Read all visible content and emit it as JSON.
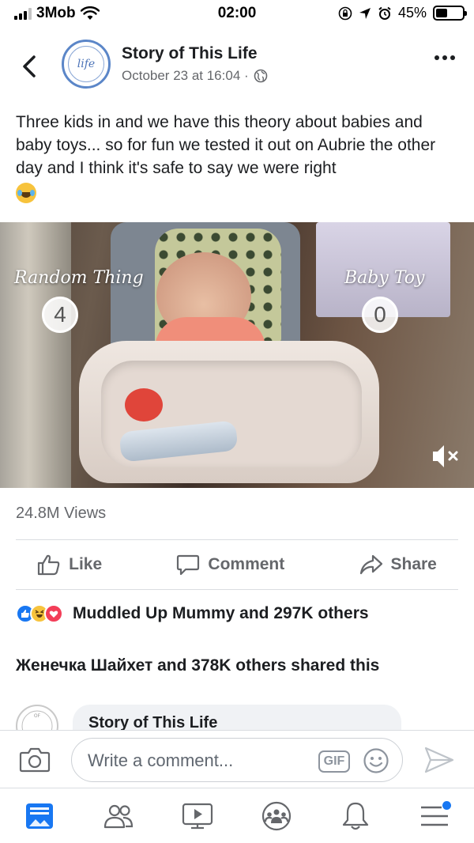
{
  "status_bar": {
    "carrier": "3Mob",
    "time": "02:00",
    "battery_percent": "45%",
    "battery_level": 0.45
  },
  "post": {
    "page_name": "Story of This Life",
    "timestamp": "October 23 at 16:04 ·",
    "text": "Three kids in and we have this theory about babies and baby toys... so for fun we tested it out on Aubrie the other day and I think it's safe to say we were right",
    "emoji": "face-with-tears-of-joy"
  },
  "video": {
    "left_label": "Random Thing",
    "left_score": "4",
    "right_label": "Baby Toy",
    "right_score": "0"
  },
  "stats": {
    "views": "24.8M Views",
    "reactions_text": "Muddled Up Mummy and 297K others",
    "shared_text": "Женечка Шайхет and 378K others shared this"
  },
  "actions": {
    "like": "Like",
    "comment": "Comment",
    "share": "Share"
  },
  "comment_preview": {
    "author": "Story of This Life"
  },
  "comment_bar": {
    "placeholder": "Write a comment...",
    "gif_label": "GIF"
  },
  "colors": {
    "accent": "#1877f2",
    "text_secondary": "#65676b",
    "divider": "#dadde1"
  }
}
